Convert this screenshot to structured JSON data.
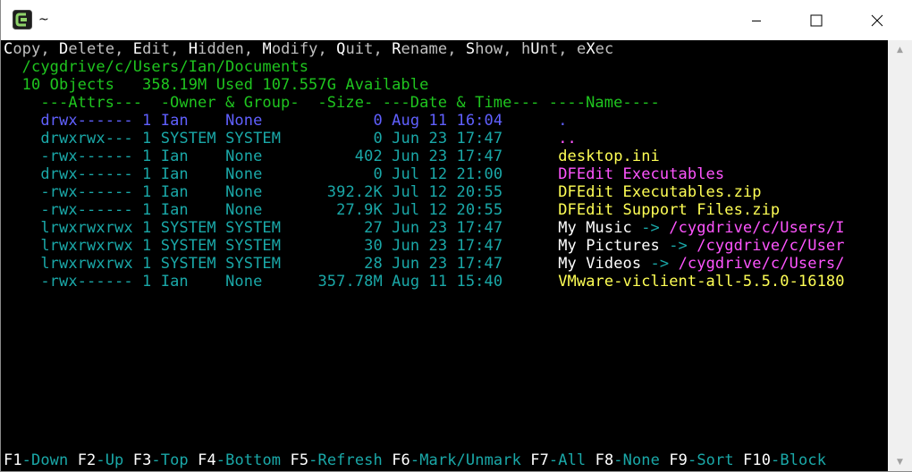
{
  "window": {
    "title": "~"
  },
  "menu_line": [
    {
      "text": "Copy",
      "hot": "C"
    },
    {
      "text": "Delete",
      "hot": "D"
    },
    {
      "text": "Edit",
      "hot": "E"
    },
    {
      "text": "Hidden",
      "hot": "H"
    },
    {
      "text": "Modify",
      "hot": "M"
    },
    {
      "text": "Quit",
      "hot": "Q"
    },
    {
      "text": "Rename",
      "hot": "R"
    },
    {
      "text": "Show",
      "hot": "S"
    },
    {
      "text": "hUnt",
      "hot": "U"
    },
    {
      "text": "eXec",
      "hot": "X"
    }
  ],
  "path": "  /cygdrive/c/Users/Ian/Documents",
  "summary": "  10 Objects   358.19M Used 107.557G Available",
  "header": "    ---Attrs---  -Owner & Group-  -Size- ---Date & Time--- ----Name----",
  "files": [
    {
      "attrs": "drwx------",
      "links": "1",
      "owner": "Ian",
      "group": "None",
      "size": "0",
      "date": "Aug 11 16:04",
      "name": ".",
      "color": "blue"
    },
    {
      "attrs": "drwxrwx---",
      "links": "1",
      "owner": "SYSTEM",
      "group": "SYSTEM",
      "size": "0",
      "date": "Jun 23 17:47",
      "name": "..",
      "color": "magenta"
    },
    {
      "attrs": "-rwx------",
      "links": "1",
      "owner": "Ian",
      "group": "None",
      "size": "402",
      "date": "Jun 23 17:47",
      "name": "desktop.ini",
      "color": "yellow"
    },
    {
      "attrs": "drwx------",
      "links": "1",
      "owner": "Ian",
      "group": "None",
      "size": "0",
      "date": "Jul 12 21:00",
      "name": "DFEdit Executables",
      "color": "magenta"
    },
    {
      "attrs": "-rwx------",
      "links": "1",
      "owner": "Ian",
      "group": "None",
      "size": "392.2K",
      "date": "Jul 12 20:55",
      "name": "DFEdit Executables.zip",
      "color": "yellow"
    },
    {
      "attrs": "-rwx------",
      "links": "1",
      "owner": "Ian",
      "group": "None",
      "size": "27.9K",
      "date": "Jul 12 20:55",
      "name": "DFEdit Support Files.zip",
      "color": "yellow"
    },
    {
      "attrs": "lrwxrwxrwx",
      "links": "1",
      "owner": "SYSTEM",
      "group": "SYSTEM",
      "size": "27",
      "date": "Jun 23 17:47",
      "name": "My Music",
      "target": "/cygdrive/c/Users/I",
      "color": "white"
    },
    {
      "attrs": "lrwxrwxrwx",
      "links": "1",
      "owner": "SYSTEM",
      "group": "SYSTEM",
      "size": "30",
      "date": "Jun 23 17:47",
      "name": "My Pictures",
      "target": "/cygdrive/c/User",
      "color": "white"
    },
    {
      "attrs": "lrwxrwxrwx",
      "links": "1",
      "owner": "SYSTEM",
      "group": "SYSTEM",
      "size": "28",
      "date": "Jun 23 17:47",
      "name": "My Videos",
      "target": "/cygdrive/c/Users/",
      "color": "white"
    },
    {
      "attrs": "-rwx------",
      "links": "1",
      "owner": "Ian",
      "group": "None",
      "size": "357.78M",
      "date": "Aug 11 15:40",
      "name": "VMware-viclient-all-5.5.0-16180",
      "color": "yellow"
    }
  ],
  "function_keys": [
    {
      "key": "F1",
      "label": "Down"
    },
    {
      "key": "F2",
      "label": "Up"
    },
    {
      "key": "F3",
      "label": "Top"
    },
    {
      "key": "F4",
      "label": "Bottom"
    },
    {
      "key": "F5",
      "label": "Refresh"
    },
    {
      "key": "F6",
      "label": "Mark/Unmark"
    },
    {
      "key": "F7",
      "label": "All"
    },
    {
      "key": "F8",
      "label": "None"
    },
    {
      "key": "F9",
      "label": "Sort"
    },
    {
      "key": "F10",
      "label": "Block"
    }
  ],
  "colors": {
    "green": "#1fc51f",
    "teal": "#1aa8a8",
    "blue": "#6060ff",
    "yellow": "#ffff55",
    "magenta": "#ff55ff",
    "white": "#ffffff",
    "gray": "#c0c0c0"
  }
}
